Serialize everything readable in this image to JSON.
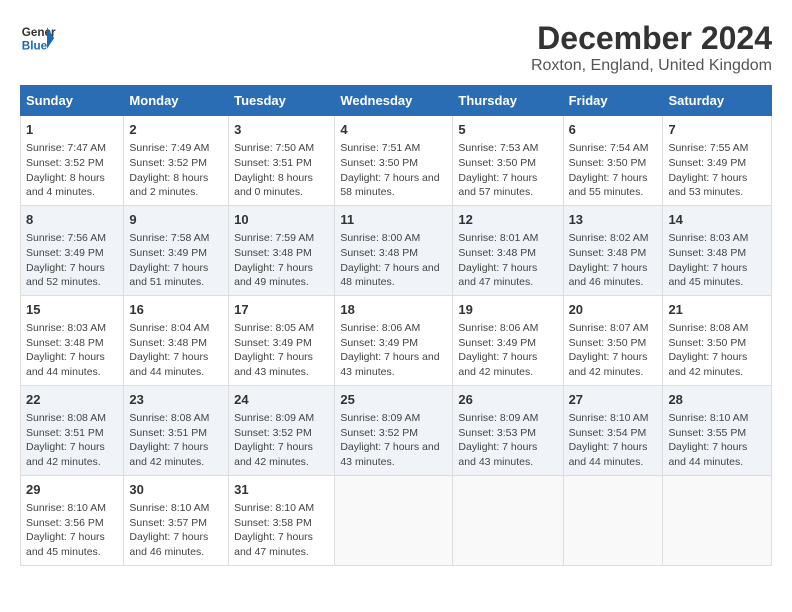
{
  "header": {
    "logo_line1": "General",
    "logo_line2": "Blue",
    "month_title": "December 2024",
    "location": "Roxton, England, United Kingdom"
  },
  "columns": [
    "Sunday",
    "Monday",
    "Tuesday",
    "Wednesday",
    "Thursday",
    "Friday",
    "Saturday"
  ],
  "weeks": [
    [
      {
        "day": "1",
        "sunrise": "7:47 AM",
        "sunset": "3:52 PM",
        "daylight": "8 hours and 4 minutes."
      },
      {
        "day": "2",
        "sunrise": "7:49 AM",
        "sunset": "3:52 PM",
        "daylight": "8 hours and 2 minutes."
      },
      {
        "day": "3",
        "sunrise": "7:50 AM",
        "sunset": "3:51 PM",
        "daylight": "8 hours and 0 minutes."
      },
      {
        "day": "4",
        "sunrise": "7:51 AM",
        "sunset": "3:50 PM",
        "daylight": "7 hours and 58 minutes."
      },
      {
        "day": "5",
        "sunrise": "7:53 AM",
        "sunset": "3:50 PM",
        "daylight": "7 hours and 57 minutes."
      },
      {
        "day": "6",
        "sunrise": "7:54 AM",
        "sunset": "3:50 PM",
        "daylight": "7 hours and 55 minutes."
      },
      {
        "day": "7",
        "sunrise": "7:55 AM",
        "sunset": "3:49 PM",
        "daylight": "7 hours and 53 minutes."
      }
    ],
    [
      {
        "day": "8",
        "sunrise": "7:56 AM",
        "sunset": "3:49 PM",
        "daylight": "7 hours and 52 minutes."
      },
      {
        "day": "9",
        "sunrise": "7:58 AM",
        "sunset": "3:49 PM",
        "daylight": "7 hours and 51 minutes."
      },
      {
        "day": "10",
        "sunrise": "7:59 AM",
        "sunset": "3:48 PM",
        "daylight": "7 hours and 49 minutes."
      },
      {
        "day": "11",
        "sunrise": "8:00 AM",
        "sunset": "3:48 PM",
        "daylight": "7 hours and 48 minutes."
      },
      {
        "day": "12",
        "sunrise": "8:01 AM",
        "sunset": "3:48 PM",
        "daylight": "7 hours and 47 minutes."
      },
      {
        "day": "13",
        "sunrise": "8:02 AM",
        "sunset": "3:48 PM",
        "daylight": "7 hours and 46 minutes."
      },
      {
        "day": "14",
        "sunrise": "8:03 AM",
        "sunset": "3:48 PM",
        "daylight": "7 hours and 45 minutes."
      }
    ],
    [
      {
        "day": "15",
        "sunrise": "8:03 AM",
        "sunset": "3:48 PM",
        "daylight": "7 hours and 44 minutes."
      },
      {
        "day": "16",
        "sunrise": "8:04 AM",
        "sunset": "3:48 PM",
        "daylight": "7 hours and 44 minutes."
      },
      {
        "day": "17",
        "sunrise": "8:05 AM",
        "sunset": "3:49 PM",
        "daylight": "7 hours and 43 minutes."
      },
      {
        "day": "18",
        "sunrise": "8:06 AM",
        "sunset": "3:49 PM",
        "daylight": "7 hours and 43 minutes."
      },
      {
        "day": "19",
        "sunrise": "8:06 AM",
        "sunset": "3:49 PM",
        "daylight": "7 hours and 42 minutes."
      },
      {
        "day": "20",
        "sunrise": "8:07 AM",
        "sunset": "3:50 PM",
        "daylight": "7 hours and 42 minutes."
      },
      {
        "day": "21",
        "sunrise": "8:08 AM",
        "sunset": "3:50 PM",
        "daylight": "7 hours and 42 minutes."
      }
    ],
    [
      {
        "day": "22",
        "sunrise": "8:08 AM",
        "sunset": "3:51 PM",
        "daylight": "7 hours and 42 minutes."
      },
      {
        "day": "23",
        "sunrise": "8:08 AM",
        "sunset": "3:51 PM",
        "daylight": "7 hours and 42 minutes."
      },
      {
        "day": "24",
        "sunrise": "8:09 AM",
        "sunset": "3:52 PM",
        "daylight": "7 hours and 42 minutes."
      },
      {
        "day": "25",
        "sunrise": "8:09 AM",
        "sunset": "3:52 PM",
        "daylight": "7 hours and 43 minutes."
      },
      {
        "day": "26",
        "sunrise": "8:09 AM",
        "sunset": "3:53 PM",
        "daylight": "7 hours and 43 minutes."
      },
      {
        "day": "27",
        "sunrise": "8:10 AM",
        "sunset": "3:54 PM",
        "daylight": "7 hours and 44 minutes."
      },
      {
        "day": "28",
        "sunrise": "8:10 AM",
        "sunset": "3:55 PM",
        "daylight": "7 hours and 44 minutes."
      }
    ],
    [
      {
        "day": "29",
        "sunrise": "8:10 AM",
        "sunset": "3:56 PM",
        "daylight": "7 hours and 45 minutes."
      },
      {
        "day": "30",
        "sunrise": "8:10 AM",
        "sunset": "3:57 PM",
        "daylight": "7 hours and 46 minutes."
      },
      {
        "day": "31",
        "sunrise": "8:10 AM",
        "sunset": "3:58 PM",
        "daylight": "7 hours and 47 minutes."
      },
      null,
      null,
      null,
      null
    ]
  ]
}
